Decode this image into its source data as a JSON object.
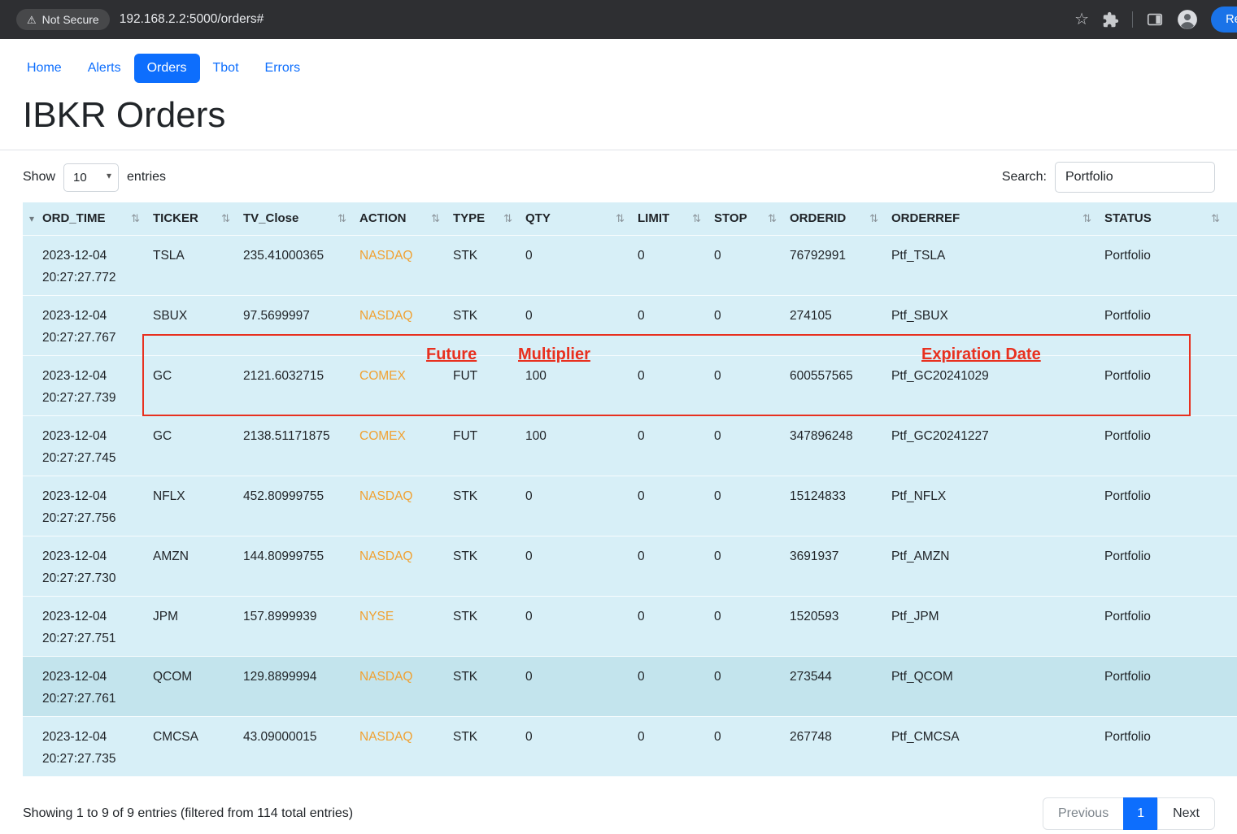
{
  "colors": {
    "accent_blue": "#0d6efd",
    "action_orange": "#f0a132",
    "annotation_red": "#e8301f",
    "table_bg": "#d7eff7",
    "table_row_highlight": "#c3e4ed",
    "chrome_bg": "#2e2f32",
    "relaunch_blue": "#1a73e8"
  },
  "browser": {
    "security_badge": "Not Secure",
    "url": "192.168.2.2:5000/orders#",
    "relaunch_label": "Relau"
  },
  "nav": {
    "items": [
      {
        "label": "Home",
        "active": false
      },
      {
        "label": "Alerts",
        "active": false
      },
      {
        "label": "Orders",
        "active": true
      },
      {
        "label": "Tbot",
        "active": false
      },
      {
        "label": "Errors",
        "active": false
      }
    ]
  },
  "page": {
    "title": "IBKR Orders"
  },
  "controls": {
    "show_label": "Show",
    "page_size": "10",
    "entries_label": "entries",
    "search_label": "Search:",
    "search_value": "Portfolio"
  },
  "table": {
    "columns": [
      "ORD_TIME",
      "TICKER",
      "TV_Close",
      "ACTION",
      "TYPE",
      "QTY",
      "LIMIT",
      "STOP",
      "ORDERID",
      "ORDERREF",
      "STATUS"
    ],
    "rows": [
      {
        "date": "2023-12-04",
        "time": "20:27:27.772",
        "ticker": "TSLA",
        "tv_close": "235.41000365",
        "action": "NASDAQ",
        "type": "STK",
        "qty": "0",
        "limit": "0",
        "stop": "0",
        "orderid": "76792991",
        "orderref": "Ptf_TSLA",
        "status": "Portfolio",
        "highlight": false
      },
      {
        "date": "2023-12-04",
        "time": "20:27:27.767",
        "ticker": "SBUX",
        "tv_close": "97.5699997",
        "action": "NASDAQ",
        "type": "STK",
        "qty": "0",
        "limit": "0",
        "stop": "0",
        "orderid": "274105",
        "orderref": "Ptf_SBUX",
        "status": "Portfolio",
        "highlight": false
      },
      {
        "date": "2023-12-04",
        "time": "20:27:27.739",
        "ticker": "GC",
        "tv_close": "2121.6032715",
        "action": "COMEX",
        "type": "FUT",
        "qty": "100",
        "limit": "0",
        "stop": "0",
        "orderid": "600557565",
        "orderref": "Ptf_GC20241029",
        "status": "Portfolio",
        "highlight": false
      },
      {
        "date": "2023-12-04",
        "time": "20:27:27.745",
        "ticker": "GC",
        "tv_close": "2138.51171875",
        "action": "COMEX",
        "type": "FUT",
        "qty": "100",
        "limit": "0",
        "stop": "0",
        "orderid": "347896248",
        "orderref": "Ptf_GC20241227",
        "status": "Portfolio",
        "highlight": false
      },
      {
        "date": "2023-12-04",
        "time": "20:27:27.756",
        "ticker": "NFLX",
        "tv_close": "452.80999755",
        "action": "NASDAQ",
        "type": "STK",
        "qty": "0",
        "limit": "0",
        "stop": "0",
        "orderid": "15124833",
        "orderref": "Ptf_NFLX",
        "status": "Portfolio",
        "highlight": false
      },
      {
        "date": "2023-12-04",
        "time": "20:27:27.730",
        "ticker": "AMZN",
        "tv_close": "144.80999755",
        "action": "NASDAQ",
        "type": "STK",
        "qty": "0",
        "limit": "0",
        "stop": "0",
        "orderid": "3691937",
        "orderref": "Ptf_AMZN",
        "status": "Portfolio",
        "highlight": false
      },
      {
        "date": "2023-12-04",
        "time": "20:27:27.751",
        "ticker": "JPM",
        "tv_close": "157.8999939",
        "action": "NYSE",
        "type": "STK",
        "qty": "0",
        "limit": "0",
        "stop": "0",
        "orderid": "1520593",
        "orderref": "Ptf_JPM",
        "status": "Portfolio",
        "highlight": false
      },
      {
        "date": "2023-12-04",
        "time": "20:27:27.761",
        "ticker": "QCOM",
        "tv_close": "129.8899994",
        "action": "NASDAQ",
        "type": "STK",
        "qty": "0",
        "limit": "0",
        "stop": "0",
        "orderid": "273544",
        "orderref": "Ptf_QCOM",
        "status": "Portfolio",
        "highlight": true
      },
      {
        "date": "2023-12-04",
        "time": "20:27:27.735",
        "ticker": "CMCSA",
        "tv_close": "43.09000015",
        "action": "NASDAQ",
        "type": "STK",
        "qty": "0",
        "limit": "0",
        "stop": "0",
        "orderid": "267748",
        "orderref": "Ptf_CMCSA",
        "status": "Portfolio",
        "highlight": false
      }
    ]
  },
  "annotations": {
    "future": "Future",
    "multiplier": "Multiplier",
    "expiration": "Expiration Date"
  },
  "footer": {
    "summary": "Showing 1 to 9 of 9 entries (filtered from 114 total entries)",
    "previous_label": "Previous",
    "page_label": "1",
    "next_label": "Next"
  }
}
